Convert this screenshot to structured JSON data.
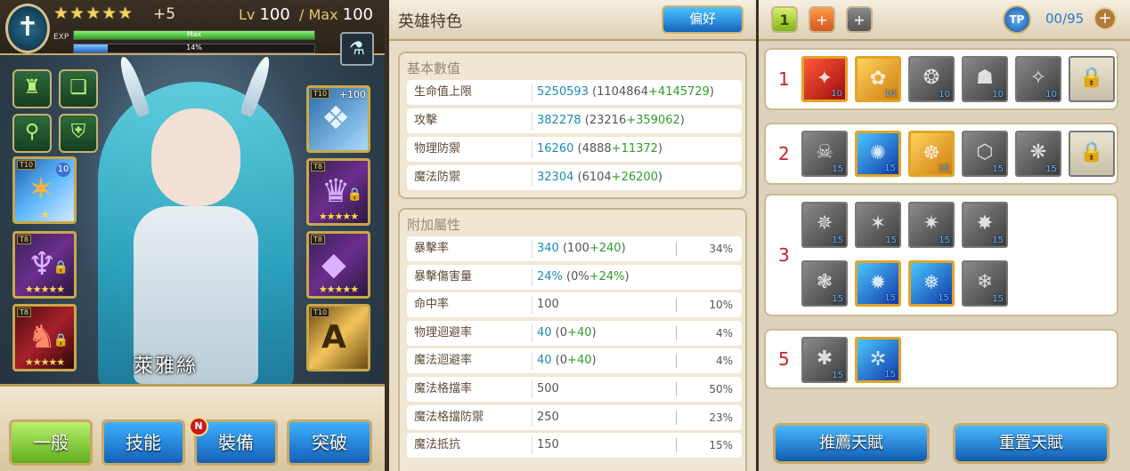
{
  "hero": {
    "stars": "★★★★★",
    "star_bonus": "+5",
    "level_label": "Lv",
    "level": "100",
    "max_label": "/ Max",
    "max_level": "100",
    "exp_label": "EXP",
    "exp_bar_text": "Max",
    "exp_fill_fraction": 1.0,
    "sub_bar_text": "14%",
    "sub_fill_fraction": 0.14,
    "name": "萊雅絲",
    "equip_bonus": "+100"
  },
  "equipment": {
    "left": [
      {
        "tier": "T10",
        "level": "10",
        "stars": "★"
      },
      {
        "tier": "T8",
        "stars": "★★★★★",
        "locked": true
      },
      {
        "tier": "T8",
        "stars": "★★★★★",
        "locked": true
      }
    ],
    "right": [
      {
        "tier": "T10",
        "bonus": "+100"
      },
      {
        "tier": "T8",
        "stars": "★★★★★",
        "locked": true
      },
      {
        "tier": "T8",
        "stars": "★★★★★"
      },
      {
        "tier": "T10",
        "glyph": "A"
      }
    ]
  },
  "tabs": {
    "general": "一般",
    "skills": "技能",
    "equip": "裝備",
    "breakthrough": "突破",
    "new_badge": "N"
  },
  "stats_panel": {
    "title": "英雄特色",
    "pref_button": "偏好",
    "base_title": "基本數值",
    "base": [
      {
        "label": "生命值上限",
        "main": "5250593",
        "base": "1104864",
        "bonus": "+4145729"
      },
      {
        "label": "攻擊",
        "main": "382278",
        "base": "23216",
        "bonus": "+359062"
      },
      {
        "label": "物理防禦",
        "main": "16260",
        "base": "4888",
        "bonus": "+11372"
      },
      {
        "label": "魔法防禦",
        "main": "32304",
        "base": "6104",
        "bonus": "+26200"
      }
    ],
    "extra_title": "附加屬性",
    "extra": [
      {
        "label": "暴擊率",
        "main": "340",
        "base": "100",
        "bonus": "+240",
        "pct": "34%",
        "colored": true
      },
      {
        "label": "暴擊傷害量",
        "main": "24%",
        "base": "0%",
        "bonus": "+24%",
        "pct": "",
        "colored": true
      },
      {
        "label": "命中率",
        "main": "100",
        "base": "",
        "bonus": "",
        "pct": "10%",
        "colored": false
      },
      {
        "label": "物理迴避率",
        "main": "40",
        "base": "0",
        "bonus": "+40",
        "pct": "4%",
        "colored": true
      },
      {
        "label": "魔法迴避率",
        "main": "40",
        "base": "0",
        "bonus": "+40",
        "pct": "4%",
        "colored": true
      },
      {
        "label": "魔法格擋率",
        "main": "500",
        "base": "",
        "bonus": "",
        "pct": "50%",
        "colored": false
      },
      {
        "label": "魔法格擋防禦",
        "main": "250",
        "base": "",
        "bonus": "",
        "pct": "23%",
        "colored": false
      },
      {
        "label": "魔法抵抗",
        "main": "150",
        "base": "",
        "bonus": "",
        "pct": "15%",
        "colored": false
      }
    ]
  },
  "talent_panel": {
    "tab1": "1",
    "tab2": "+",
    "tab3": "+",
    "tp_label": "TP",
    "tp_count": "00/95",
    "tp_plus": "+",
    "rows": [
      {
        "num": "1",
        "icons": [
          {
            "style": "red",
            "lvl": "10",
            "sym": "✦"
          },
          {
            "style": "gold",
            "lvl": "10",
            "sym": "✿"
          },
          {
            "style": "grey",
            "lvl": "10",
            "sym": "❂"
          },
          {
            "style": "grey",
            "lvl": "10",
            "sym": "☗"
          },
          {
            "style": "grey",
            "lvl": "10",
            "sym": "✧"
          },
          {
            "style": "lock",
            "lvl": "",
            "sym": "🔒"
          }
        ]
      },
      {
        "num": "2",
        "icons": [
          {
            "style": "grey",
            "lvl": "15",
            "sym": "☠"
          },
          {
            "style": "blue",
            "lvl": "15",
            "sym": "✺"
          },
          {
            "style": "gold",
            "lvl": "15",
            "sym": "☸"
          },
          {
            "style": "grey",
            "lvl": "15",
            "sym": "⬡"
          },
          {
            "style": "grey",
            "lvl": "15",
            "sym": "❋"
          },
          {
            "style": "lock",
            "lvl": "",
            "sym": "🔒"
          }
        ]
      },
      {
        "num": "3",
        "icons": [
          {
            "style": "grey",
            "lvl": "15",
            "sym": "✵"
          },
          {
            "style": "grey",
            "lvl": "15",
            "sym": "✶"
          },
          {
            "style": "grey",
            "lvl": "15",
            "sym": "✷"
          },
          {
            "style": "grey",
            "lvl": "15",
            "sym": "✸"
          },
          {
            "style": "grey",
            "lvl": "15",
            "sym": "❃"
          },
          {
            "style": "blue",
            "lvl": "15",
            "sym": "✹"
          },
          {
            "style": "blue",
            "lvl": "15",
            "sym": "❅"
          },
          {
            "style": "grey",
            "lvl": "15",
            "sym": "❄"
          }
        ]
      },
      {
        "num": "5",
        "icons": [
          {
            "style": "grey",
            "lvl": "15",
            "sym": "✱"
          },
          {
            "style": "blue",
            "lvl": "15",
            "sym": "✲"
          }
        ]
      }
    ],
    "recommend_button": "推薦天賦",
    "reset_button": "重置天賦"
  }
}
